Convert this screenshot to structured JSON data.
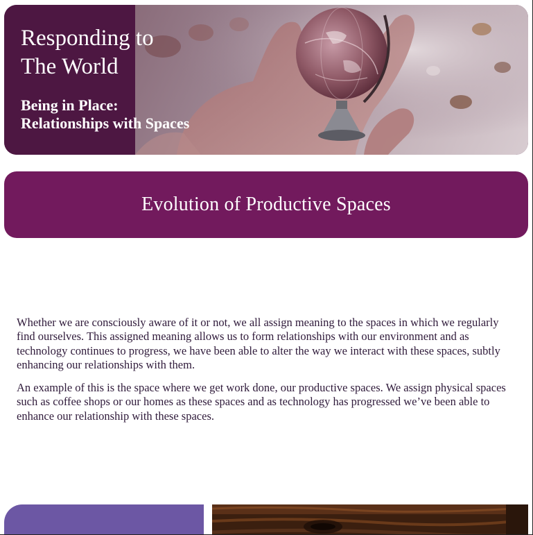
{
  "hero": {
    "title": "Responding to\nThe World",
    "subtitle": "Being in Place:\nRelationships with Spaces",
    "image": "hand-holding-globe-photo"
  },
  "section": {
    "title": "Evolution of Productive Spaces"
  },
  "content": {
    "paragraphs": [
      "Whether we are consciously aware of it or not, we all assign meaning to the spaces in which we regularly find ourselves. This assigned meaning allows us to form relationships with our environment and as technology continues to progress, we have been able to alter the way we interact with these spaces, subtly enhancing our relationships with them.",
      "An example of this is the space where we get work done, our productive spaces. We assign physical spaces such as coffee shops or our homes as these spaces and as technology has progressed we’ve been able to enhance our relationship with these spaces."
    ]
  },
  "bottom_cards": {
    "left_color": "#6c57a4",
    "right_image": "dark-wood-texture"
  },
  "colors": {
    "hero_panel": "#4d1742",
    "banner": "#721a5d",
    "body_text": "#2f1a3a"
  }
}
